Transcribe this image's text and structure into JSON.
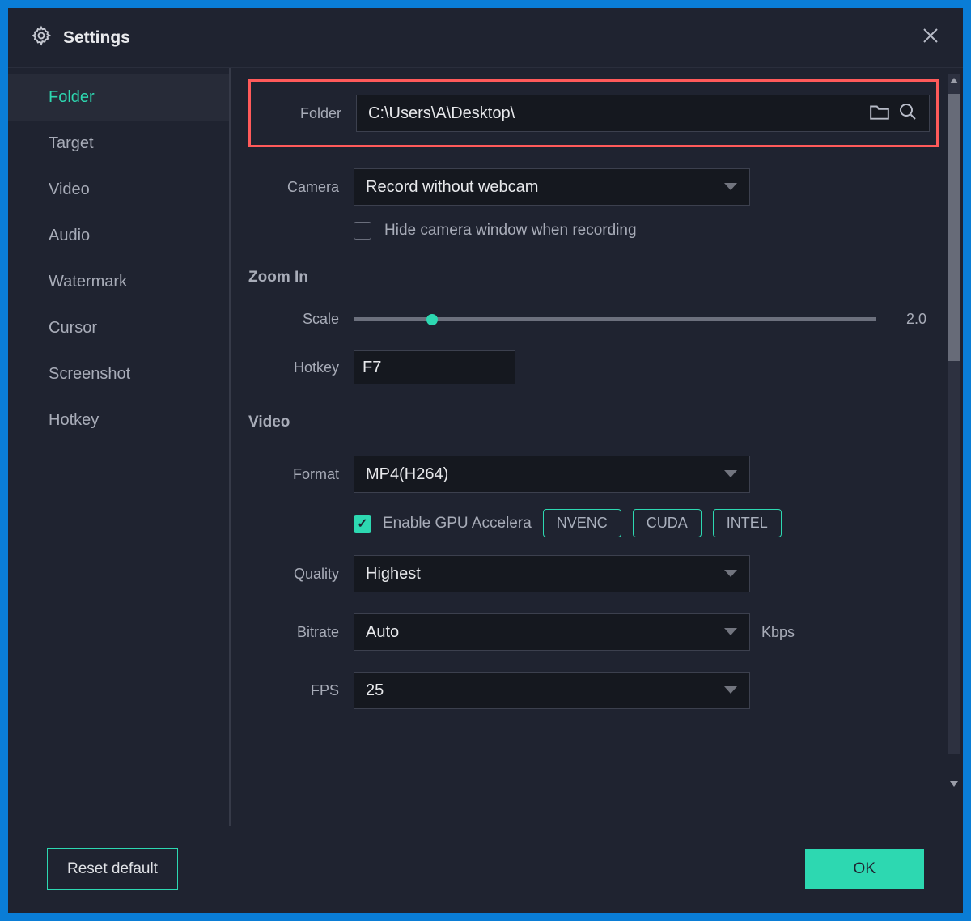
{
  "title": "Settings",
  "sidebar": {
    "items": [
      {
        "label": "Folder",
        "active": true
      },
      {
        "label": "Target",
        "active": false
      },
      {
        "label": "Video",
        "active": false
      },
      {
        "label": "Audio",
        "active": false
      },
      {
        "label": "Watermark",
        "active": false
      },
      {
        "label": "Cursor",
        "active": false
      },
      {
        "label": "Screenshot",
        "active": false
      },
      {
        "label": "Hotkey",
        "active": false
      }
    ]
  },
  "folder": {
    "label": "Folder",
    "path": "C:\\Users\\A\\Desktop\\"
  },
  "camera": {
    "label": "Camera",
    "value": "Record without webcam",
    "hide_label": "Hide camera window when recording",
    "hide_checked": false
  },
  "zoom": {
    "section": "Zoom In",
    "scale_label": "Scale",
    "scale_value": "2.0",
    "scale_pos_pct": 15,
    "hotkey_label": "Hotkey",
    "hotkey_value": "F7"
  },
  "video": {
    "section": "Video",
    "format_label": "Format",
    "format_value": "MP4(H264)",
    "gpu_checked": true,
    "gpu_label": "Enable GPU Accelera",
    "gpu_options": [
      "NVENC",
      "CUDA",
      "INTEL"
    ],
    "quality_label": "Quality",
    "quality_value": "Highest",
    "bitrate_label": "Bitrate",
    "bitrate_value": "Auto",
    "bitrate_unit": "Kbps",
    "fps_label": "FPS",
    "fps_value": "25"
  },
  "footer": {
    "reset": "Reset default",
    "ok": "OK"
  }
}
